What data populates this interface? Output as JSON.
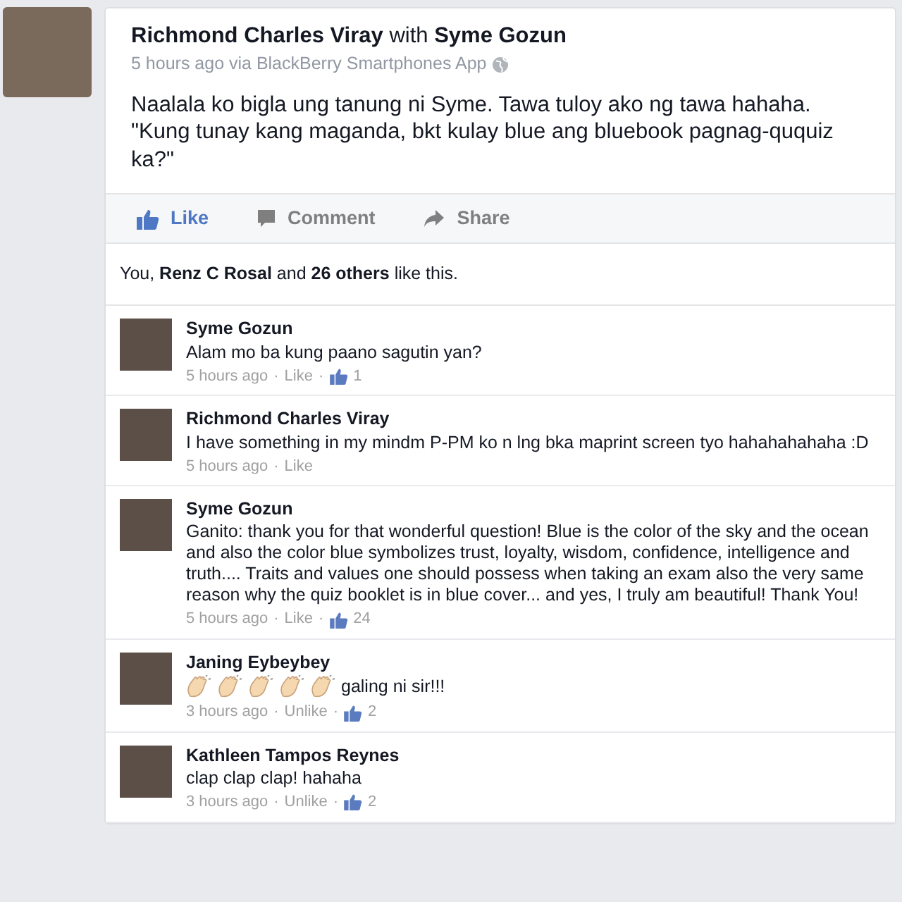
{
  "post": {
    "header": "**Richmond Charles Viray** with **Syme Gozun**",
    "meta": "5 hours ago via BlackBerry Smartphones App",
    "text": "Naalala ko bigla ung tanung ni Syme. Tawa tuloy ako ng tawa hahaha. \"Kung tunay kang maganda, bkt kulay blue ang bluebook pagnag-ququiz ka?\"",
    "actions": [
      {
        "kind": "like",
        "label": "Like",
        "active": true
      },
      {
        "kind": "comment",
        "label": "Comment",
        "active": false
      },
      {
        "kind": "share",
        "label": "Share",
        "active": false
      }
    ],
    "likes_summary": "You, **Renz C Rosal** and **26 others** like this."
  },
  "comments": [
    {
      "name": "Syme Gozun",
      "text": "Alam mo ba kung paano sagutin yan?",
      "time": "5 hours ago",
      "sep1": "·",
      "action": "Like",
      "sep2": "·",
      "likes": "1"
    },
    {
      "name": "Richmond Charles Viray",
      "text": "I have something in my mindm P-PM ko n lng bka maprint screen tyo hahahahahaha :D",
      "time": "5 hours ago",
      "sep1": "·",
      "action": "Like"
    },
    {
      "name": "Syme Gozun",
      "text": "Ganito: thank you for that wonderful question! Blue is the color of the sky and the ocean and also the color blue symbolizes trust, loyalty, wisdom, confidence, intelligence and truth.... Traits and values one should possess when taking an exam also the very same reason why the quiz booklet is in blue cover... and yes, I truly am beautiful! Thank You!",
      "time": "5 hours ago",
      "sep1": "·",
      "action": "Like",
      "sep2": "·",
      "likes": "24"
    },
    {
      "name": "Janing Eybeybey",
      "emoji": [
        {
          "kind": "clap"
        },
        {
          "kind": "clap"
        },
        {
          "kind": "clap"
        },
        {
          "kind": "clap"
        },
        {
          "kind": "clap"
        }
      ],
      "text": "galing ni sir!!!",
      "time": "3 hours ago",
      "sep1": "·",
      "action": "Unlike",
      "sep2": "·",
      "likes": "2"
    },
    {
      "name": "Kathleen Tampos Reynes",
      "text": "clap clap clap! hahaha",
      "time": "3 hours ago",
      "sep1": "·",
      "action": "Unlike",
      "sep2": "·",
      "likes": "2"
    }
  ]
}
